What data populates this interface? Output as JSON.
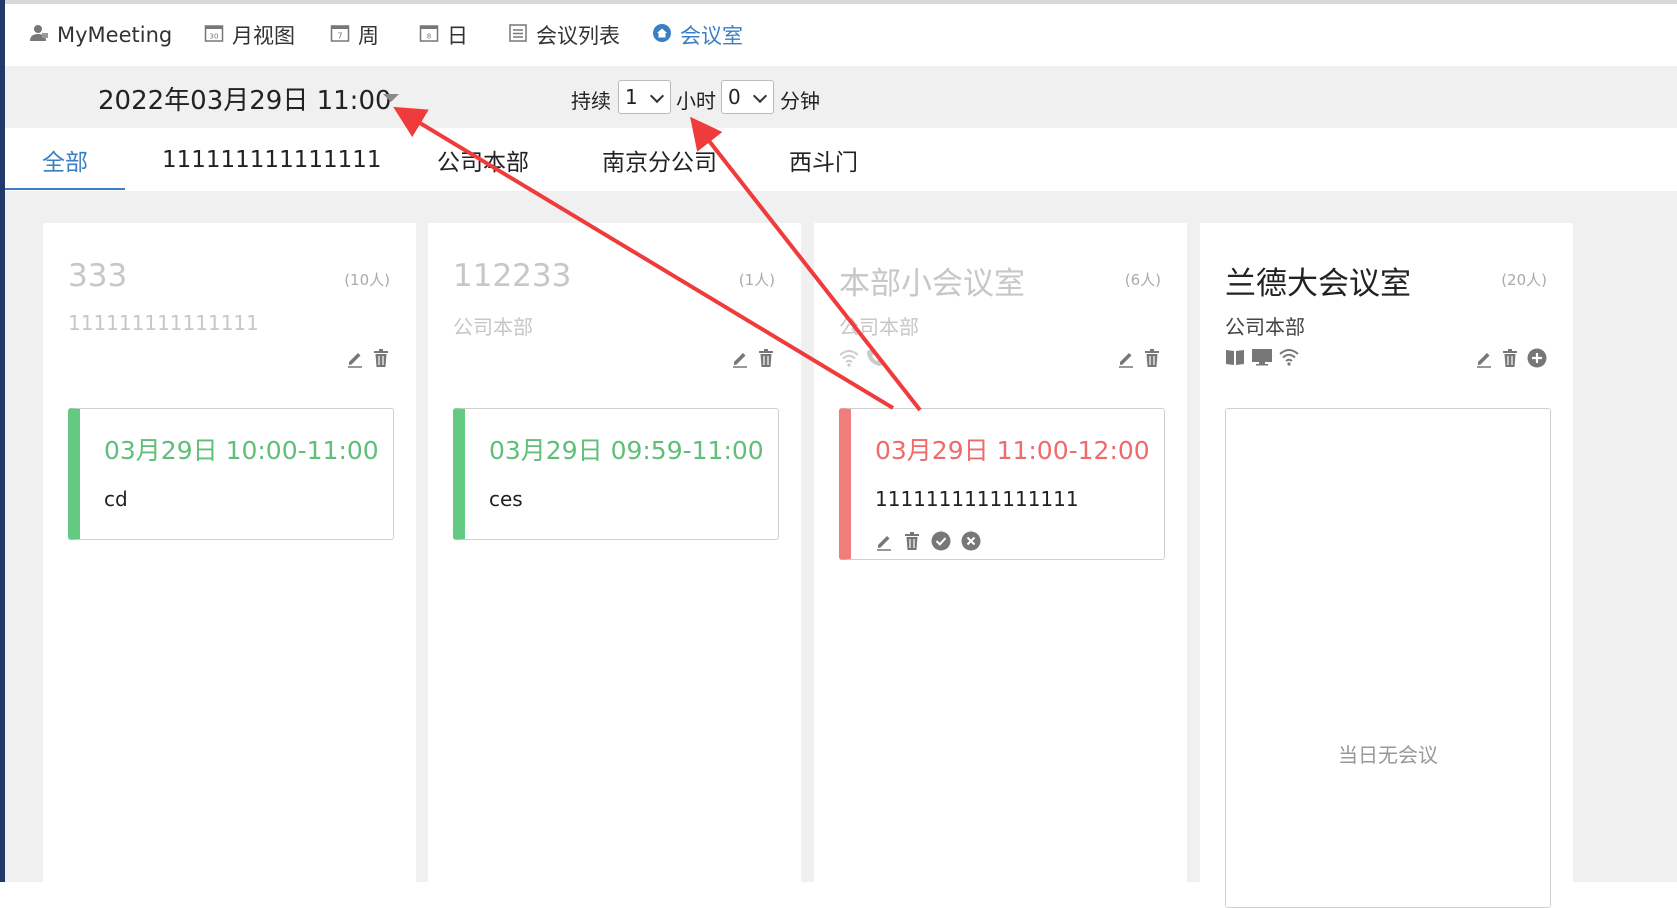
{
  "nav": {
    "items": [
      {
        "label": "MyMeeting",
        "icon": "user-icon"
      },
      {
        "label": "月视图",
        "icon": "calendar-month-icon",
        "icon_text": "30"
      },
      {
        "label": "周",
        "icon": "calendar-week-icon",
        "icon_text": "7"
      },
      {
        "label": "日",
        "icon": "calendar-day-icon",
        "icon_text": "8"
      },
      {
        "label": "会议列表",
        "icon": "list-icon"
      },
      {
        "label": "会议室",
        "icon": "home-icon"
      }
    ]
  },
  "toolbar": {
    "datetime": "2022年03月29日 11:00",
    "duration_label": "持续",
    "hours_value": "1",
    "hours_unit": "小时",
    "minutes_value": "0",
    "minutes_unit": "分钟"
  },
  "tabs": [
    "全部",
    "111111111111111",
    "公司本部",
    "南京分公司",
    "西斗门"
  ],
  "rooms": [
    {
      "name": "333",
      "capacity": "(10人)",
      "branch": "111111111111111",
      "meeting": {
        "time": "03月29日 10:00-11:00",
        "title": "cd"
      }
    },
    {
      "name": "112233",
      "capacity": "(1人)",
      "branch": "公司本部",
      "meeting": {
        "time": "03月29日 09:59-11:00",
        "title": "ces"
      }
    },
    {
      "name": "本部小会议室",
      "capacity": "(6人)",
      "branch": "公司本部",
      "meeting": {
        "time": "03月29日 11:00-12:00",
        "title": "1111111111111111"
      }
    },
    {
      "name": "兰德大会议室",
      "capacity": "(20人)",
      "branch": "公司本部",
      "empty_text": "当日无会议"
    }
  ],
  "colors": {
    "accent": "#3b7ec3",
    "meeting_green": "#5fbf78",
    "meeting_red": "#ef6a6a",
    "annotation_arrow": "#ef3b3b"
  }
}
